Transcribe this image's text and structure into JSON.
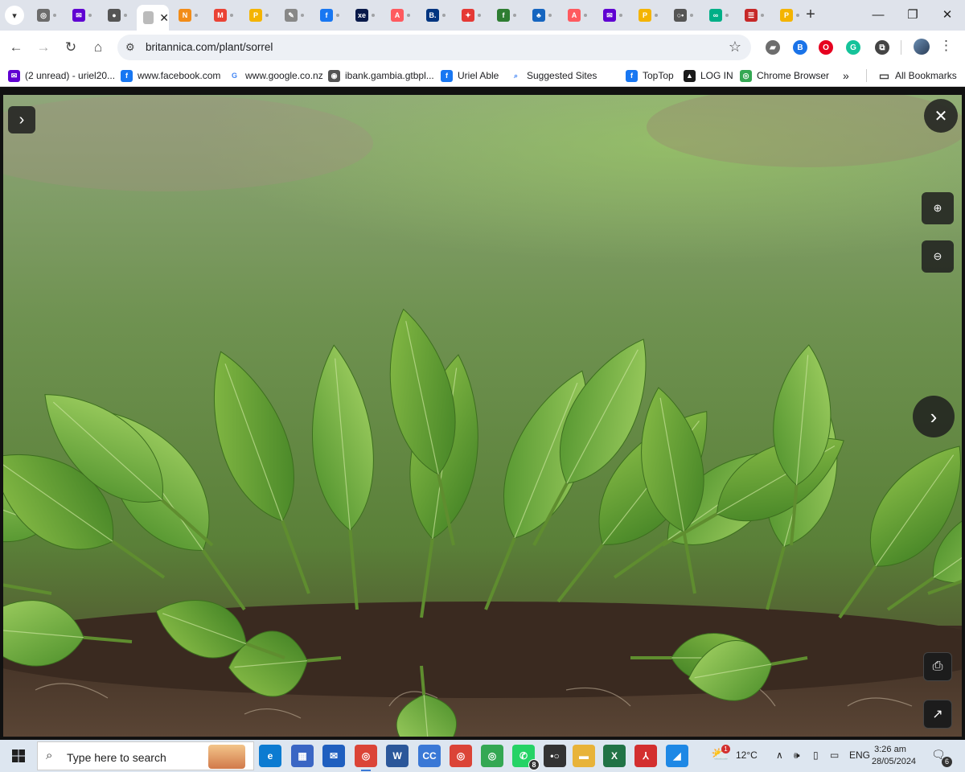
{
  "browser": {
    "url": "britannica.com/plant/sorrel",
    "tabs": [
      {
        "icon": "chrome-icon",
        "color": "#6c6c6c",
        "glyph": "◎"
      },
      {
        "icon": "yahoo-mail-icon",
        "color": "#6001d2",
        "glyph": "✉"
      },
      {
        "icon": "camera-icon",
        "color": "#555555",
        "glyph": "●"
      },
      {
        "icon": "loading-icon",
        "color": "#bbbbbb",
        "glyph": "",
        "active": true
      },
      {
        "icon": "newsnow-icon",
        "color": "#f28c18",
        "glyph": "N"
      },
      {
        "icon": "gmail-icon",
        "color": "#ea4335",
        "glyph": "M"
      },
      {
        "icon": "google-ads-icon",
        "color": "#f4b400",
        "glyph": "P"
      },
      {
        "icon": "pen-icon",
        "color": "#888888",
        "glyph": "✎"
      },
      {
        "icon": "facebook-icon",
        "color": "#1877f2",
        "glyph": "f"
      },
      {
        "icon": "xe-icon",
        "color": "#0a1a4a",
        "glyph": "xe"
      },
      {
        "icon": "airbnb-icon",
        "color": "#ff5a5f",
        "glyph": "A"
      },
      {
        "icon": "booking-icon",
        "color": "#003580",
        "glyph": "B."
      },
      {
        "icon": "puzzle-color-icon",
        "color": "#e53935",
        "glyph": "✦"
      },
      {
        "icon": "green-app-icon",
        "color": "#2e7d32",
        "glyph": "f"
      },
      {
        "icon": "people-icon",
        "color": "#1565c0",
        "glyph": "♣"
      },
      {
        "icon": "airbnb-icon",
        "color": "#ff5a5f",
        "glyph": "A"
      },
      {
        "icon": "yahoo-mail-icon",
        "color": "#6001d2",
        "glyph": "✉"
      },
      {
        "icon": "google-ads-icon",
        "color": "#f4b400",
        "glyph": "P"
      },
      {
        "icon": "dots-icon",
        "color": "#555555",
        "glyph": "○•"
      },
      {
        "icon": "tripadvisor-icon",
        "color": "#00af87",
        "glyph": "∞"
      },
      {
        "icon": "flag-icon",
        "color": "#c62828",
        "glyph": "☰"
      },
      {
        "icon": "google-ads-icon",
        "color": "#f4b400",
        "glyph": "P"
      }
    ],
    "new_tab_label": "+",
    "window_buttons": {
      "minimize": "—",
      "restore": "❐",
      "close": "✕"
    }
  },
  "toolbar": {
    "back": "←",
    "forward": "→",
    "reload": "↻",
    "home": "⌂",
    "site_info": "⚙",
    "bookmark_star": "☆",
    "menu": "⋮",
    "extensions": [
      {
        "icon": "cast-icon",
        "color": "#6d6d6d",
        "glyph": "▰"
      },
      {
        "icon": "blue-extension-icon",
        "color": "#1a73e8",
        "glyph": "B"
      },
      {
        "icon": "opera-icon",
        "color": "#e6001f",
        "glyph": "O"
      },
      {
        "icon": "grammarly-icon",
        "color": "#15c39a",
        "glyph": "G"
      },
      {
        "icon": "puzzle-icon",
        "color": "#444444",
        "glyph": "⧉"
      }
    ]
  },
  "bookmarks": [
    {
      "label": "(2 unread) - uriel20...",
      "icon": "yahoo-mail-icon",
      "color": "#6001d2",
      "glyph": "✉"
    },
    {
      "label": "www.facebook.com",
      "icon": "facebook-icon",
      "color": "#1877f2",
      "glyph": "f"
    },
    {
      "label": "www.google.co.nz",
      "icon": "google-icon",
      "color": "#ffffff",
      "glyph": "G"
    },
    {
      "label": "ibank.gambia.gtbpl...",
      "icon": "globe-icon",
      "color": "#555555",
      "glyph": "◉"
    },
    {
      "label": "Uriel Able",
      "icon": "facebook-icon",
      "color": "#1877f2",
      "glyph": "f"
    },
    {
      "label": "Suggested Sites",
      "icon": "search-icon",
      "color": "#ffffff",
      "glyph": "⌕"
    },
    {
      "label": "TopTop",
      "icon": "facebook-icon",
      "color": "#1877f2",
      "glyph": "f"
    },
    {
      "label": "LOG IN",
      "icon": "login-icon",
      "color": "#1a1a1a",
      "glyph": "▲"
    },
    {
      "label": "Chrome Browser",
      "icon": "chrome-icon",
      "color": "#34a853",
      "glyph": "◎"
    }
  ],
  "bookmarks_more": "»",
  "all_bookmarks": "All Bookmarks",
  "viewer": {
    "prev_label": "›",
    "close_label": "✕",
    "zoom_in": "🔍+",
    "zoom_out": "🔍−",
    "next_label": "›",
    "print": "🖨",
    "open_new": "↗"
  },
  "taskbar": {
    "search_placeholder": "Type here to search",
    "apps": [
      {
        "icon": "edge-icon",
        "color": "#0c7bd1",
        "glyph": "e"
      },
      {
        "icon": "store-icon",
        "color": "#3a66c4",
        "glyph": "▦"
      },
      {
        "icon": "mail-icon",
        "color": "#1f5fbf",
        "glyph": "✉"
      },
      {
        "icon": "chrome-icon",
        "color": "#db4437",
        "glyph": "◎",
        "running": true
      },
      {
        "icon": "word-icon",
        "color": "#2b579a",
        "glyph": "W"
      },
      {
        "icon": "calculator-icon",
        "color": "#3a78d6",
        "glyph": "CC"
      },
      {
        "icon": "chrome-icon",
        "color": "#db4437",
        "glyph": "◎"
      },
      {
        "icon": "chrome-icon",
        "color": "#34a853",
        "glyph": "◎"
      },
      {
        "icon": "whatsapp-icon",
        "color": "#25d366",
        "glyph": "✆",
        "badge": "8"
      },
      {
        "icon": "dots-icon",
        "color": "#333333",
        "glyph": "•○"
      },
      {
        "icon": "file-explorer-icon",
        "color": "#e8b339",
        "glyph": "▬"
      },
      {
        "icon": "excel-icon",
        "color": "#217346",
        "glyph": "X"
      },
      {
        "icon": "acrobat-icon",
        "color": "#d32f2f",
        "glyph": "⅄"
      },
      {
        "icon": "photos-icon",
        "color": "#1e88e5",
        "glyph": "◢"
      }
    ],
    "weather_temp": "12°C",
    "weather_badge": "1",
    "tray_chevron": "∧",
    "language": "ENG",
    "time": "3:26 am",
    "date": "28/05/2024",
    "notification_count": "6"
  }
}
